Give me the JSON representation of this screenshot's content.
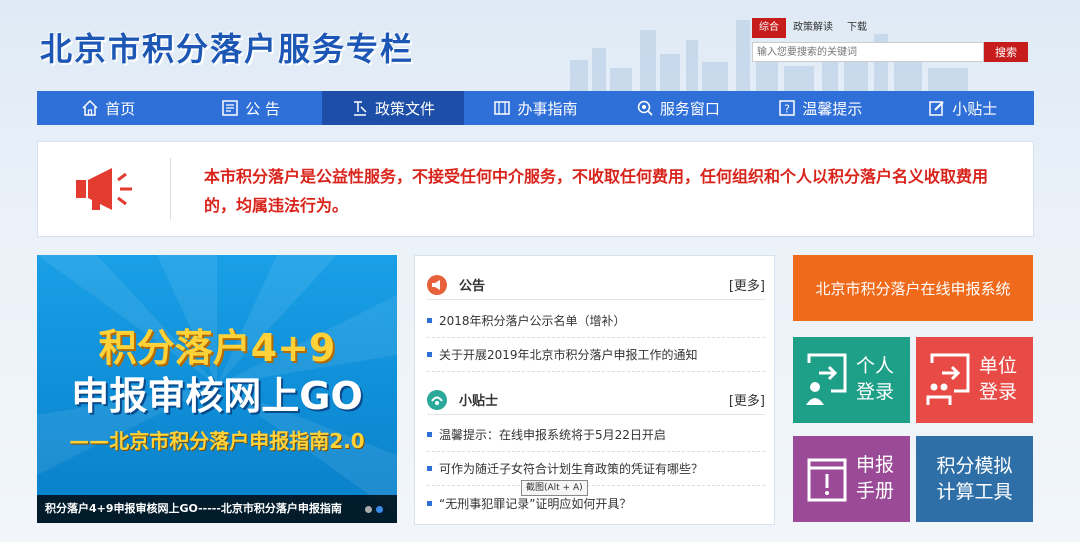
{
  "header": {
    "title": "北京市积分落户服务专栏",
    "search_tabs": [
      "综合",
      "政策解读",
      "下载"
    ],
    "search_placeholder": "输入您要搜索的关键词",
    "search_button": "搜索"
  },
  "nav": {
    "items": [
      {
        "label": "首页",
        "icon": "home-icon"
      },
      {
        "label": "公 告",
        "icon": "notice-board-icon"
      },
      {
        "label": "政策文件",
        "icon": "policy-file-icon"
      },
      {
        "label": "办事指南",
        "icon": "guide-icon"
      },
      {
        "label": "服务窗口",
        "icon": "service-window-icon"
      },
      {
        "label": "温馨提示",
        "icon": "help-icon"
      },
      {
        "label": "小贴士",
        "icon": "edit-note-icon"
      }
    ],
    "active_index": 2
  },
  "notice": {
    "text": "本市积分落户是公益性服务，不接受任何中介服务，不收取任何费用，任何组织和个人以积分落户名义收取费用的，均属违法行为。"
  },
  "banner": {
    "line1": "积分落户4+9",
    "line2": "申报审核网上GO",
    "line3": "——北京市积分落户申报指南2.0",
    "caption": "积分落户4+9申报审核网上GO-----北京市积分落户申报指南"
  },
  "announcements": {
    "title": "公告",
    "more": "[更多]",
    "items": [
      "2018年积分落户公示名单（增补）",
      "关于开展2019年北京市积分落户申报工作的通知"
    ]
  },
  "tips": {
    "title": "小贴士",
    "more": "[更多]",
    "items": [
      "温馨提示：在线申报系统将于5月22日开启",
      "可作为随迁子女符合计划生育政策的凭证有哪些？",
      "“无刑事犯罪记录”证明应如何开具？"
    ]
  },
  "tooltip": "截图(Alt + A)",
  "tiles": {
    "online_system": "北京市积分落户在线申报系统",
    "personal_login": "个人登录",
    "unit_login": "单位登录",
    "manual": "申报手册",
    "calculator": "积分模拟计算工具"
  },
  "colors": {
    "nav_blue": "#2f6fd8",
    "nav_active": "#1d4fa8",
    "notice_red": "#d9241c",
    "tile_orange": "#ef6a1b",
    "tile_teal": "#1e9f88",
    "tile_red": "#e84a45",
    "tile_purple": "#9b4a97",
    "tile_blue": "#2f6fa8"
  }
}
